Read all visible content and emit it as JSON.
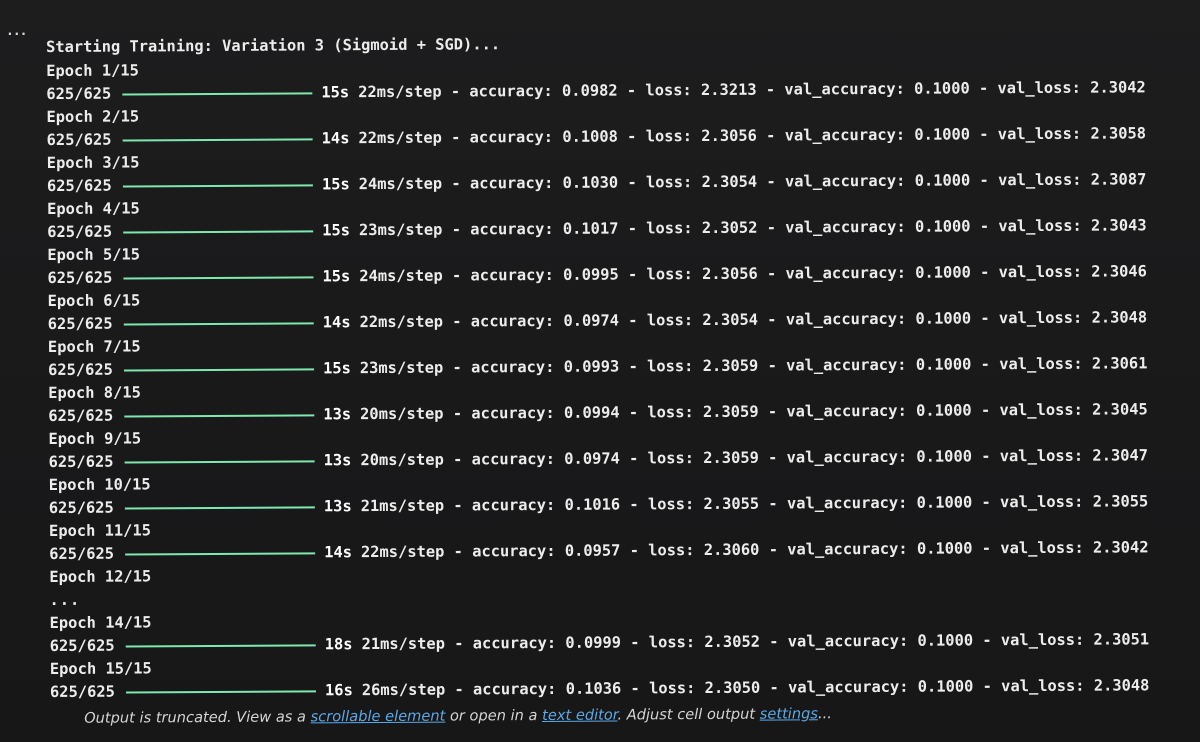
{
  "gutter": {
    "ellipsis": "..."
  },
  "output": {
    "header": "Starting Training: Variation 3 (Sigmoid + SGD)...",
    "bar_color": "#7fe8b0",
    "epochs": [
      {
        "epoch": "Epoch 1/15",
        "steps": "625/625",
        "time": "15s",
        "metrics": "22ms/step - accuracy: 0.0982 - loss: 2.3213 - val_accuracy: 0.1000 - val_loss: 2.3042"
      },
      {
        "epoch": "Epoch 2/15",
        "steps": "625/625",
        "time": "14s",
        "metrics": "22ms/step - accuracy: 0.1008 - loss: 2.3056 - val_accuracy: 0.1000 - val_loss: 2.3058"
      },
      {
        "epoch": "Epoch 3/15",
        "steps": "625/625",
        "time": "15s",
        "metrics": "24ms/step - accuracy: 0.1030 - loss: 2.3054 - val_accuracy: 0.1000 - val_loss: 2.3087"
      },
      {
        "epoch": "Epoch 4/15",
        "steps": "625/625",
        "time": "15s",
        "metrics": "23ms/step - accuracy: 0.1017 - loss: 2.3052 - val_accuracy: 0.1000 - val_loss: 2.3043"
      },
      {
        "epoch": "Epoch 5/15",
        "steps": "625/625",
        "time": "15s",
        "metrics": "24ms/step - accuracy: 0.0995 - loss: 2.3056 - val_accuracy: 0.1000 - val_loss: 2.3046"
      },
      {
        "epoch": "Epoch 6/15",
        "steps": "625/625",
        "time": "14s",
        "metrics": "22ms/step - accuracy: 0.0974 - loss: 2.3054 - val_accuracy: 0.1000 - val_loss: 2.3048"
      },
      {
        "epoch": "Epoch 7/15",
        "steps": "625/625",
        "time": "15s",
        "metrics": "23ms/step - accuracy: 0.0993 - loss: 2.3059 - val_accuracy: 0.1000 - val_loss: 2.3061"
      },
      {
        "epoch": "Epoch 8/15",
        "steps": "625/625",
        "time": "13s",
        "metrics": "20ms/step - accuracy: 0.0994 - loss: 2.3059 - val_accuracy: 0.1000 - val_loss: 2.3045"
      },
      {
        "epoch": "Epoch 9/15",
        "steps": "625/625",
        "time": "13s",
        "metrics": "20ms/step - accuracy: 0.0974 - loss: 2.3059 - val_accuracy: 0.1000 - val_loss: 2.3047"
      },
      {
        "epoch": "Epoch 10/15",
        "steps": "625/625",
        "time": "13s",
        "metrics": "21ms/step - accuracy: 0.1016 - loss: 2.3055 - val_accuracy: 0.1000 - val_loss: 2.3055"
      },
      {
        "epoch": "Epoch 11/15",
        "steps": "625/625",
        "time": "14s",
        "metrics": "22ms/step - accuracy: 0.0957 - loss: 2.3060 - val_accuracy: 0.1000 - val_loss: 2.3042"
      }
    ],
    "epoch_12": "Epoch 12/15",
    "truncation_dots": "...",
    "late_epochs": [
      {
        "epoch": "Epoch 14/15",
        "steps": "625/625",
        "time": "18s",
        "metrics": "21ms/step - accuracy: 0.0999 - loss: 2.3052 - val_accuracy: 0.1000 - val_loss: 2.3051"
      },
      {
        "epoch": "Epoch 15/15",
        "steps": "625/625",
        "time": "16s",
        "metrics": "26ms/step - accuracy: 0.1036 - loss: 2.3050 - val_accuracy: 0.1000 - val_loss: 2.3048"
      }
    ]
  },
  "truncation_note": {
    "prefix": "Output is truncated. View as a ",
    "link_scrollable": "scrollable element",
    "middle": " or open in a ",
    "link_text_editor": "text editor",
    "after_editor": ". Adjust cell output ",
    "link_settings": "settings",
    "suffix": "..."
  }
}
